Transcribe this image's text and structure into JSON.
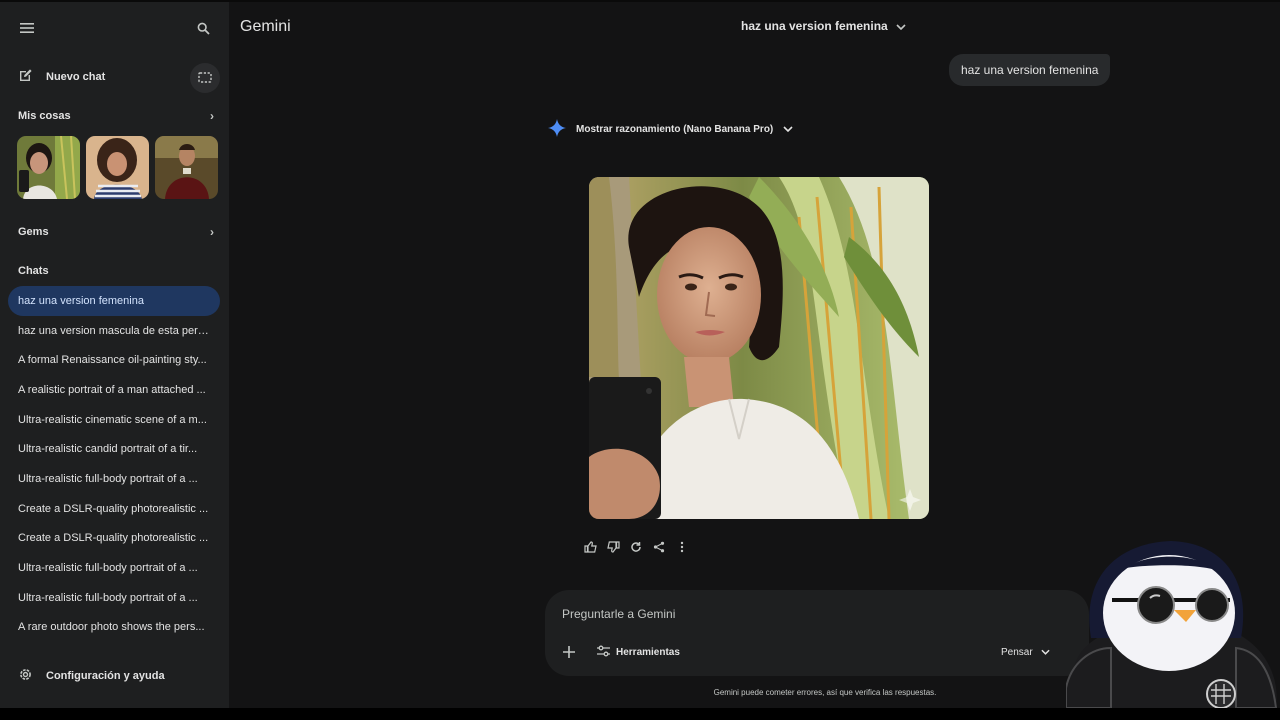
{
  "sidebar": {
    "new_chat_label": "Nuevo chat",
    "my_stuff_label": "Mis cosas",
    "gems_label": "Gems",
    "chats_label": "Chats",
    "chats": [
      "haz una version femenina",
      "haz una version mascula de esta pers...",
      "A formal Renaissance oil-painting sty...",
      "A realistic portrait of a man attached ...",
      "Ultra-realistic cinematic scene of a m...",
      "Ultra-realistic candid portrait of a tir...",
      "Ultra-realistic full-body portrait of a ...",
      "Create a DSLR-quality photorealistic ...",
      "Create a DSLR-quality photorealistic ...",
      "Ultra-realistic full-body portrait of a ...",
      "Ultra-realistic full-body portrait of a ...",
      "A rare outdoor photo shows the pers..."
    ],
    "active_chat_index": 0,
    "settings_label": "Configuración y ayuda"
  },
  "header": {
    "brand": "Gemini",
    "conversation_title": "haz una version femenina"
  },
  "conversation": {
    "user_message": "haz una version femenina",
    "reasoning_label": "Mostrar razonamiento (Nano Banana Pro)"
  },
  "composer": {
    "placeholder": "Preguntarle a Gemini",
    "tools_label": "Herramientas",
    "mode_label": "Pensar"
  },
  "disclaimer": "Gemini puede cometer errores, así que verifica las respuestas.",
  "colors": {
    "sidebar_bg": "#1e1f20",
    "main_bg": "#131314",
    "active_item_bg": "#1f3760",
    "gemini_spark": "#4e8df5"
  }
}
